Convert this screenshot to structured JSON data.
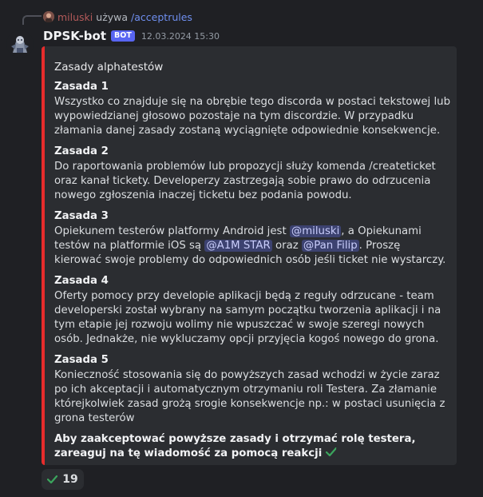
{
  "reply": {
    "username": "miluski",
    "action": "używa",
    "command": "/acceptrules"
  },
  "message": {
    "author": "DPSK-bot",
    "badge": "BOT",
    "timestamp": "12.03.2024 15:30"
  },
  "embed": {
    "accent_color": "#e62c2c",
    "title": "Zasady alphatestów",
    "rules": [
      {
        "title": "Zasada 1",
        "text": "Wszystko co znajduje się na obrębie tego discorda w postaci tekstowej lub wypowiedzianej głosowo pozostaje na tym discordzie. W przypadku złamania danej zasady zostaną wyciągnięte odpowiednie konsekwencje."
      },
      {
        "title": "Zasada 2",
        "text": "Do raportowania problemów lub propozycji służy komenda /createticket oraz kanał tickety. Developerzy zastrzegają sobie prawo do odrzucenia nowego zgłoszenia inaczej ticketu bez podania powodu."
      },
      {
        "title": "Zasada 3",
        "text_1": "Opiekunem testerów platformy Android jest ",
        "mention_1": "@miluski",
        "text_2": ", a Opiekunami testów na platformie iOS są ",
        "mention_2": "@A1M STAR",
        "text_3": " oraz ",
        "mention_3": "@Pan Filip",
        "text_4": ". Proszę kierować swoje problemy do odpowiednich osób jeśli ticket nie wystarczy."
      },
      {
        "title": "Zasada 4",
        "text": "Oferty pomocy przy developie aplikacji będą z reguły odrzucane - team developerski został wybrany na samym początku tworzenia aplikacji i na tym etapie jej rozwoju wolimy nie wpuszczać w swoje szeregi nowych osób. Jednakże, nie wykluczamy opcji przyjęcia kogoś nowego do grona."
      },
      {
        "title": "Zasada 5",
        "text": "Konieczność stosowania się do powyższych zasad wchodzi w życie zaraz po ich akceptacji i automatycznym otrzymaniu roli Testera. Za złamanie którejkolwiek zasad grożą srogie konsekwencje np.: w postaci usunięcia z grona testerów"
      }
    ],
    "footer": "Aby zaakceptować powyższe zasady i otrzymać rolę testera, zareaguj na tę wiadomość za pomocą reakcji"
  },
  "reaction": {
    "icon": "check-mark-emoji",
    "count": "19"
  },
  "colors": {
    "mention_bg": "#3c4270",
    "bot_badge": "#5865f2",
    "check_green": "#3ba55d"
  }
}
